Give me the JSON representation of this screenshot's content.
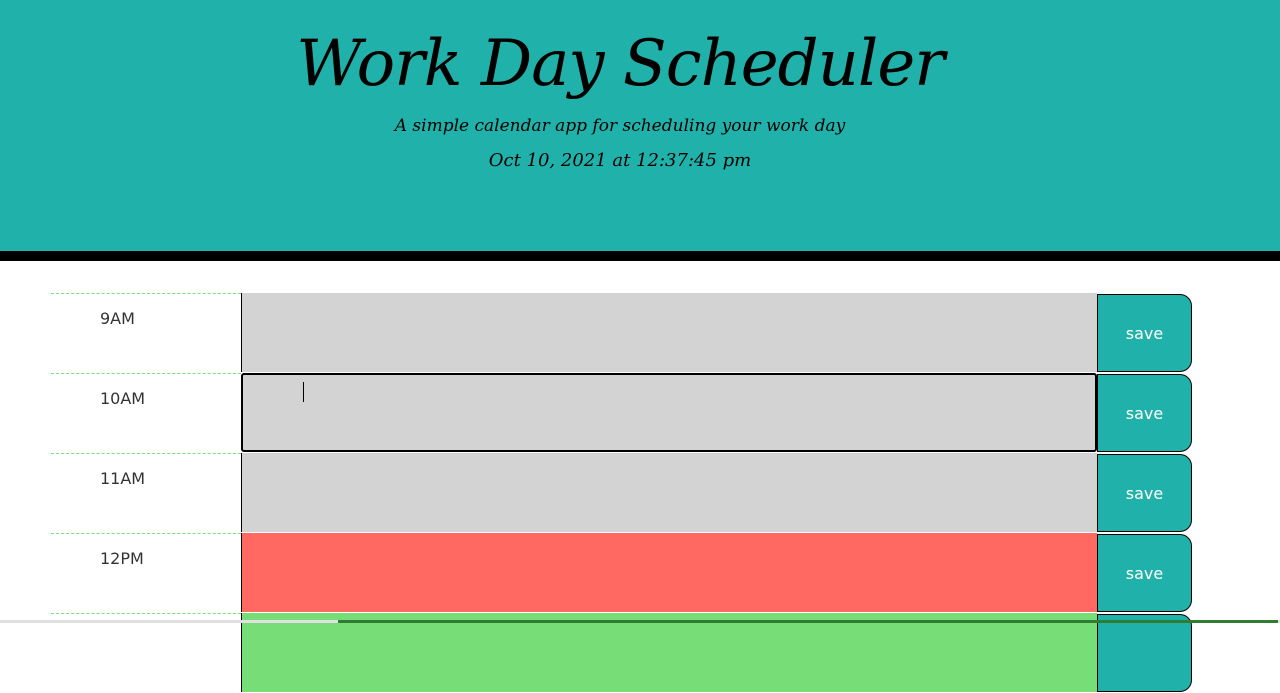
{
  "header": {
    "title": "Work Day Scheduler",
    "subtitle": "A simple calendar app for scheduling your work day",
    "datetime": "Oct 10, 2021 at 12:37:45 pm"
  },
  "schedule": {
    "rows": [
      {
        "hour": "9AM",
        "task": "",
        "state": "future",
        "save_label": "save"
      },
      {
        "hour": "10AM",
        "task": "",
        "state": "future",
        "save_label": "save"
      },
      {
        "hour": "11AM",
        "task": "",
        "state": "future",
        "save_label": "save"
      },
      {
        "hour": "12PM",
        "task": "",
        "state": "present",
        "save_label": "save"
      },
      {
        "hour": "",
        "task": "",
        "state": "past-green",
        "save_label": ""
      }
    ]
  },
  "colors": {
    "header_bg": "#20b2aa",
    "future": "#d3d3d3",
    "present": "#ff6961",
    "next_row": "#77dd77",
    "save_button": "#20b2aa"
  }
}
